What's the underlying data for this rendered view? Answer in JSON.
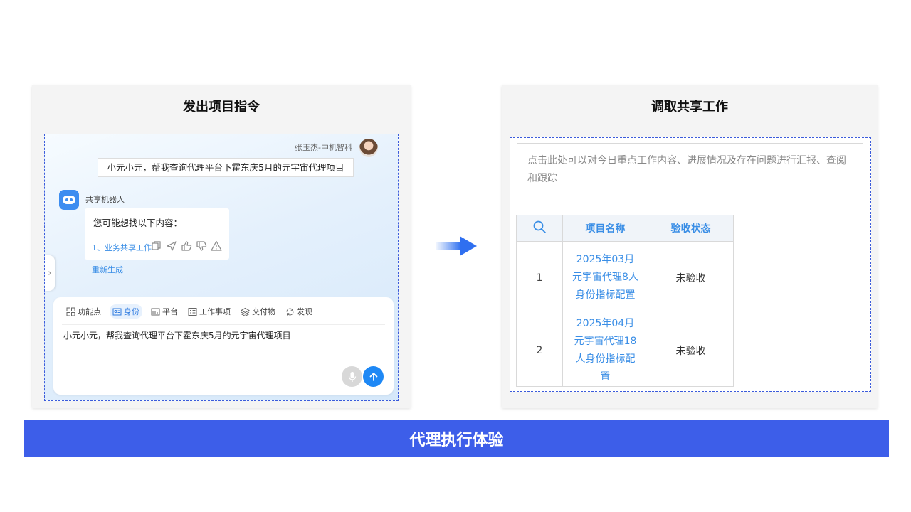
{
  "left_panel": {
    "title": "发出项目指令",
    "user_name": "张玉杰-中机智科",
    "user_message": "小元小元，帮我查询代理平台下霍东庆5月的元宇宙代理项目",
    "bot_name": "共享机器人",
    "bot_prompt": "您可能想找以下内容：",
    "bot_suggestion": "1、业务共享工作",
    "regenerate_label": "重新生成",
    "toolbar": [
      {
        "label": "功能点",
        "icon": "grid-icon"
      },
      {
        "label": "身份",
        "icon": "id-card-icon"
      },
      {
        "label": "平台",
        "icon": "platform-icon"
      },
      {
        "label": "工作事项",
        "icon": "list-icon"
      },
      {
        "label": "交付物",
        "icon": "layers-icon"
      },
      {
        "label": "发现",
        "icon": "refresh-icon"
      }
    ],
    "input_text": "小元小元，帮我查询代理平台下霍东庆5月的元宇宙代理项目"
  },
  "right_panel": {
    "title": "调取共享工作",
    "notes_placeholder": "点击此处可以对今日重点工作内容、进展情况及存在问题进行汇报、查阅和跟踪",
    "table": {
      "headers": [
        "项目名称",
        "验收状态"
      ],
      "rows": [
        {
          "index": "1",
          "name": "2025年03月元宇宙代理8人身份指标配置",
          "status": "未验收"
        },
        {
          "index": "2",
          "name": "2025年04月元宇宙代理18人身份指标配置",
          "status": "未验收"
        }
      ]
    }
  },
  "banner": {
    "text": "代理执行体验"
  },
  "colors": {
    "accent": "#3d5ee9",
    "link": "#3a8ee6",
    "send": "#1e88f5"
  }
}
